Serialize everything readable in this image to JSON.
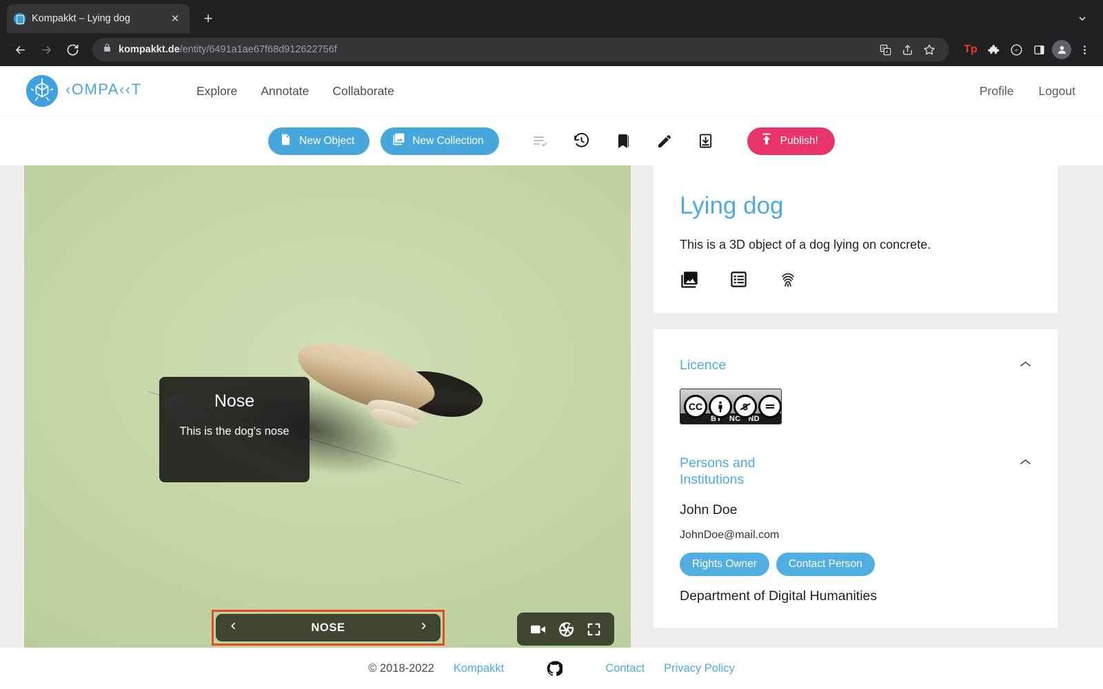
{
  "browser": {
    "tab": {
      "title": "Kompakkt – Lying dog",
      "favicon": "kompakkt-favicon",
      "close": "✕"
    },
    "new_tab_label": "+",
    "tab_list_icon": "chevron-down-icon",
    "nav": {
      "back": "←",
      "forward": "→",
      "reload": "⟳"
    },
    "omnibox": {
      "lock_icon": "lock-icon",
      "url_domain": "kompakkt.de",
      "url_path": "/entity/6491a1ae67f68d912622756f",
      "translate_icon": "translate-icon",
      "share_icon": "share-icon",
      "bookmark_icon": "star-icon"
    },
    "extensions": [
      {
        "name": "tp-extension-icon",
        "label": "Tp",
        "color": "#ef3b2d"
      },
      {
        "name": "puzzle-extensions-icon",
        "label": "🧩"
      },
      {
        "name": "leaf-extension-icon",
        "label": "leaf"
      },
      {
        "name": "side-panel-icon",
        "label": "panel"
      }
    ],
    "profile_icon": "avatar-icon",
    "menu_icon": "kebab-menu-icon"
  },
  "header": {
    "brand": "KOMPAKKT",
    "logo_icon": "kompakkt-cube-logo",
    "nav": [
      {
        "label": "Explore",
        "name": "nav-explore"
      },
      {
        "label": "Annotate",
        "name": "nav-annotate"
      },
      {
        "label": "Collaborate",
        "name": "nav-collaborate"
      }
    ],
    "right": [
      {
        "label": "Profile",
        "name": "nav-profile"
      },
      {
        "label": "Logout",
        "name": "nav-logout"
      }
    ]
  },
  "toolbar": {
    "new_object": "New Object",
    "new_collection": "New Collection",
    "publish": "Publish!",
    "icons": [
      {
        "name": "playlist-check-icon",
        "state": "disabled"
      },
      {
        "name": "history-restore-icon",
        "state": "enabled"
      },
      {
        "name": "bookmarks-icon",
        "state": "enabled"
      },
      {
        "name": "pencil-edit-icon",
        "state": "enabled"
      },
      {
        "name": "download-box-icon",
        "state": "enabled"
      }
    ],
    "colors": {
      "primary": "#46a7dd",
      "publish": "#e8346b"
    }
  },
  "viewer": {
    "background_color": "#c3d4a4",
    "annotation_popup": {
      "title": "Nose",
      "description": "This is the dog's nose"
    },
    "annotation_nav": {
      "prev_icon": "chevron-left-icon",
      "next_icon": "chevron-right-icon",
      "label": "NOSE",
      "highlight_color": "#e8491d",
      "bar_color": "#3e4531"
    },
    "controls": [
      {
        "name": "video-record-icon",
        "label": "video"
      },
      {
        "name": "camera-shutter-icon",
        "label": "screenshot"
      },
      {
        "name": "fullscreen-icon",
        "label": "fullscreen"
      }
    ]
  },
  "object": {
    "title": "Lying dog",
    "title_color": "#4cabe3",
    "description": "This is a 3D object of a dog lying on concrete.",
    "actions": [
      {
        "name": "media-gallery-icon"
      },
      {
        "name": "metadata-list-icon"
      },
      {
        "name": "fingerprint-icon"
      }
    ]
  },
  "licence": {
    "section_title": "Licence",
    "collapse_icon": "chevron-up-icon",
    "badge": {
      "name": "cc-by-nc-nd-badge",
      "cc": "CC",
      "marks": [
        "BY",
        "NC",
        "ND"
      ]
    }
  },
  "persons": {
    "section_title": "Persons and Institutions",
    "collapse_icon": "chevron-up-icon",
    "name": "John Doe",
    "email": "JohnDoe@mail.com",
    "roles": [
      "Rights Owner",
      "Contact Person"
    ],
    "institution": "Department of Digital Humanities",
    "chip_color": "#51aee0"
  },
  "footer": {
    "copyright": "© 2018-2022",
    "brand_link": "Kompakkt",
    "github_icon": "github-icon",
    "contact": "Contact",
    "privacy": "Privacy Policy"
  }
}
